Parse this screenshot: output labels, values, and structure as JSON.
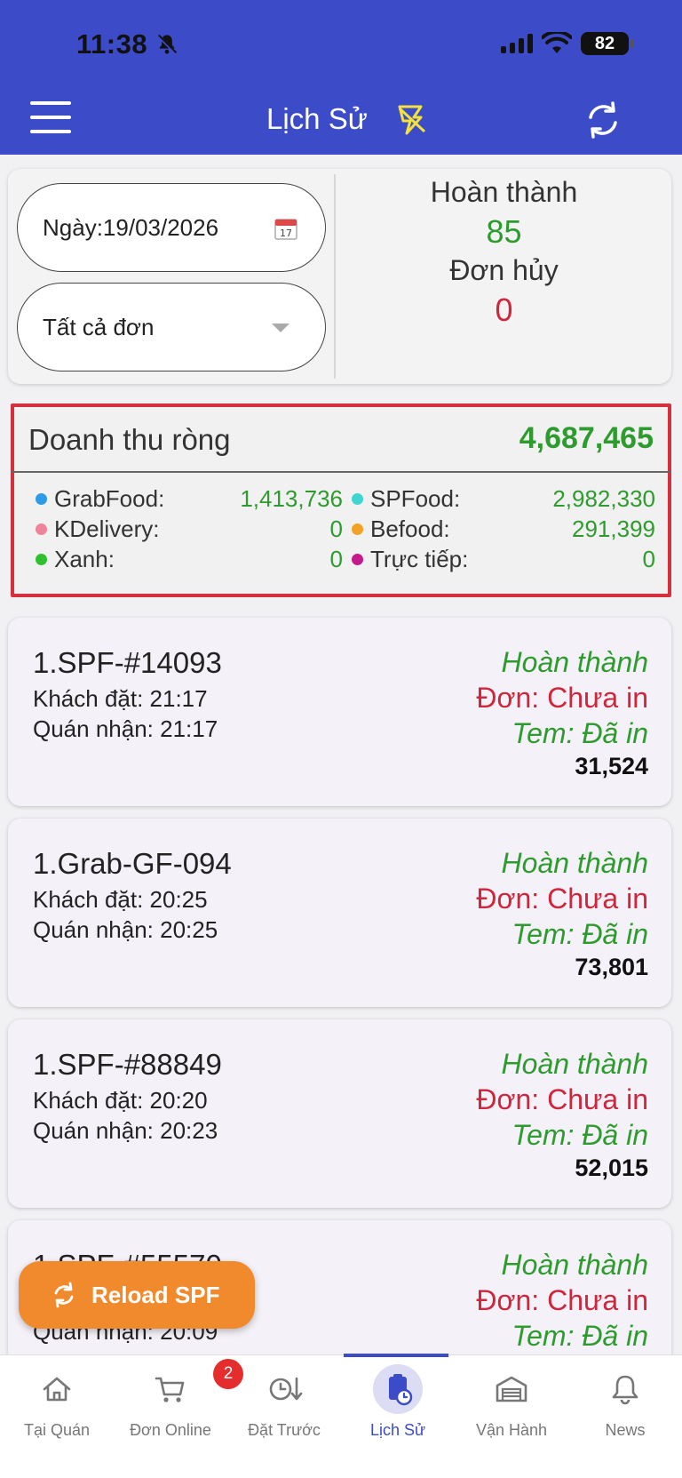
{
  "status_bar": {
    "time": "11:38",
    "battery": "82"
  },
  "header": {
    "title": "Lịch Sử"
  },
  "filter": {
    "date_label": "Ngày:19/03/2026",
    "order_type": "Tất cả đơn"
  },
  "stats": {
    "completed_label": "Hoàn thành",
    "completed_value": "85",
    "cancelled_label": "Đơn hủy",
    "cancelled_value": "0"
  },
  "revenue": {
    "title": "Doanh thu ròng",
    "total": "4,687,465",
    "channels": [
      {
        "name": "GrabFood:",
        "value": "1,413,736",
        "color": "#2d9be6"
      },
      {
        "name": "SPFood:",
        "value": "2,982,330",
        "color": "#3fd6cf"
      },
      {
        "name": "KDelivery:",
        "value": "0",
        "color": "#f0849a"
      },
      {
        "name": "Befood:",
        "value": "291,399",
        "color": "#f2a323"
      },
      {
        "name": "Xanh:",
        "value": "0",
        "color": "#2fc02f"
      },
      {
        "name": "Trực tiếp:",
        "value": "0",
        "color": "#c51a8a"
      }
    ]
  },
  "orders": [
    {
      "id": "1.SPF-#14093",
      "customer": "Khách đặt: 21:17",
      "received": "Quán nhận: 21:17",
      "status": "Hoàn thành",
      "print": "Đơn: Chưa in",
      "tem": "Tem: Đã in",
      "amount": "31,524"
    },
    {
      "id": "1.Grab-GF-094",
      "customer": "Khách đặt: 20:25",
      "received": "Quán nhận: 20:25",
      "status": "Hoàn thành",
      "print": "Đơn: Chưa in",
      "tem": "Tem: Đã in",
      "amount": "73,801"
    },
    {
      "id": "1.SPF-#88849",
      "customer": "Khách đặt: 20:20",
      "received": "Quán nhận: 20:23",
      "status": "Hoàn thành",
      "print": "Đơn: Chưa in",
      "tem": "Tem: Đã in",
      "amount": "52,015"
    },
    {
      "id": "1.SPF-#55570",
      "customer": "",
      "received": "Quán nhận: 20:09",
      "status": "Hoàn thành",
      "print": "Đơn: Chưa in",
      "tem": "Tem: Đã in",
      "amount": ""
    }
  ],
  "reload_button": "Reload SPF",
  "bottom_nav": [
    {
      "label": "Tại Quán",
      "icon": "home-icon"
    },
    {
      "label": "Đơn Online",
      "icon": "cart-icon",
      "badge": "2"
    },
    {
      "label": "Đặt Trước",
      "icon": "clock-download-icon"
    },
    {
      "label": "Lịch Sử",
      "icon": "history-clipboard-icon",
      "active": true
    },
    {
      "label": "Vận Hành",
      "icon": "warehouse-icon"
    },
    {
      "label": "News",
      "icon": "bell-icon"
    }
  ],
  "colors": {
    "header": "#3c4cc8",
    "accent_green": "#2e9b2e",
    "accent_red": "#d0263c",
    "reload_orange": "#f08a2c"
  }
}
